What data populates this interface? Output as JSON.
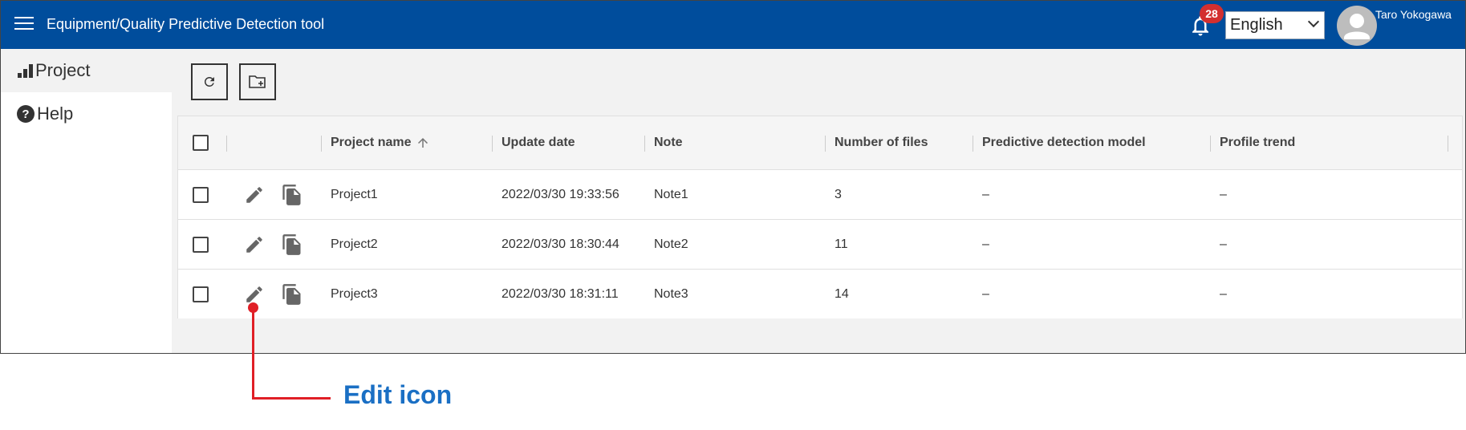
{
  "header": {
    "title": "Equipment/Quality Predictive Detection tool",
    "notification_count": "28",
    "language": "English",
    "user_name": "Taro Yokogawa"
  },
  "sidebar": {
    "items": [
      {
        "label": "Project",
        "icon": "bar-chart-icon"
      },
      {
        "label": "Help",
        "icon": "help-icon"
      }
    ]
  },
  "toolbar": {
    "buttons": [
      "refresh-icon",
      "new-folder-icon"
    ]
  },
  "table": {
    "columns": [
      "Project name",
      "Update date",
      "Note",
      "Number of files",
      "Predictive detection model",
      "Profile trend"
    ],
    "sort_column": "Project name",
    "sort_direction": "ascending",
    "rows": [
      {
        "name": "Project1",
        "date": "2022/03/30 19:33:56",
        "note": "Note1",
        "files": "3",
        "model": "–",
        "trend": "–"
      },
      {
        "name": "Project2",
        "date": "2022/03/30 18:30:44",
        "note": "Note2",
        "files": "11",
        "model": "–",
        "trend": "–"
      },
      {
        "name": "Project3",
        "date": "2022/03/30 18:31:11",
        "note": "Note3",
        "files": "14",
        "model": "–",
        "trend": "–"
      }
    ]
  },
  "annotation": {
    "label": "Edit icon"
  },
  "colors": {
    "header_bg": "#004d9c",
    "badge": "#d32f2f",
    "annotation_line": "#e01f26",
    "annotation_text": "#1a6fc4"
  }
}
